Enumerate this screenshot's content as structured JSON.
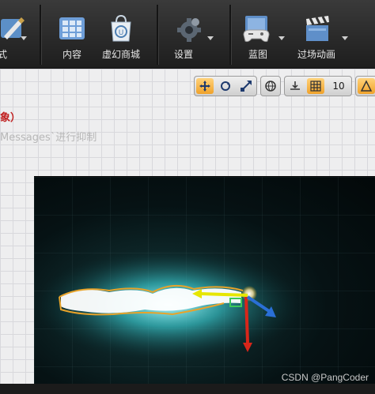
{
  "toolbar": {
    "items": [
      {
        "label": "式",
        "icon": "mode-icon"
      },
      {
        "label": "内容",
        "icon": "content-icon"
      },
      {
        "label": "虚幻商城",
        "icon": "marketplace-icon"
      },
      {
        "label": "设置",
        "icon": "settings-gear-icon"
      },
      {
        "label": "蓝图",
        "icon": "blueprint-controller-icon"
      },
      {
        "label": "过场动画",
        "icon": "cinematics-clapper-icon"
      }
    ]
  },
  "viewport_tools": {
    "grid_snap_value": "10",
    "active_color": "#f0a22a"
  },
  "viewport_overlay": {
    "red_text": "象）",
    "message_text": "Messages`进行抑制"
  },
  "preview": {
    "watermark": "CSDN @PangCoder"
  }
}
